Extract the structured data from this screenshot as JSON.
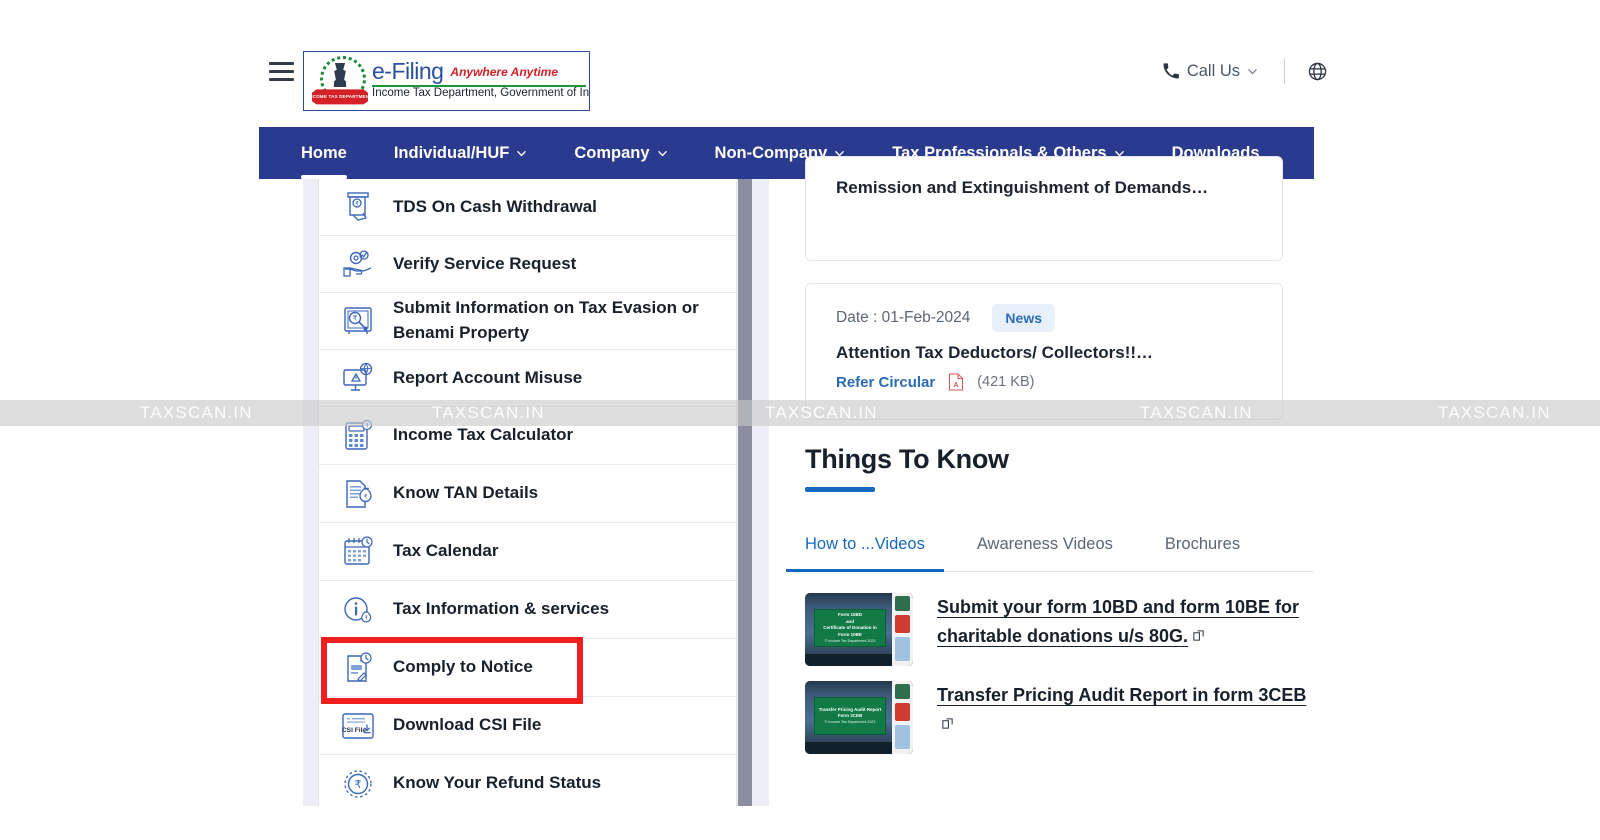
{
  "header": {
    "menu_icon": "hamburger-icon",
    "logo": {
      "brand": "e-Filing",
      "tagline": "Anywhere Anytime",
      "subtitle": "Income Tax Department, Government of India",
      "emblem_ribbon": "INCOME TAX DEPARTMENT"
    },
    "call_us_label": "Call Us",
    "phone_icon": "phone-icon",
    "caret_icon": "chevron-down-icon",
    "language_icon": "globe-icon"
  },
  "nav": {
    "items": [
      {
        "label": "Home",
        "has_caret": false,
        "active": true
      },
      {
        "label": "Individual/HUF",
        "has_caret": true,
        "active": false
      },
      {
        "label": "Company",
        "has_caret": true,
        "active": false
      },
      {
        "label": "Non-Company",
        "has_caret": true,
        "active": false
      },
      {
        "label": "Tax Professionals & Others",
        "has_caret": true,
        "active": false
      },
      {
        "label": "Downloads",
        "has_caret": false,
        "active": false
      }
    ]
  },
  "sidebar": {
    "items": [
      {
        "label": "TDS On Cash Withdrawal",
        "icon": "atm-cash-icon",
        "highlighted": false
      },
      {
        "label": "Verify Service Request",
        "icon": "hand-gear-check-icon",
        "highlighted": false
      },
      {
        "label": "Submit Information on Tax Evasion or Benami Property",
        "icon": "safe-magnifier-rupee-icon",
        "highlighted": false
      },
      {
        "label": "Report Account Misuse",
        "icon": "monitor-warning-icon",
        "highlighted": false
      },
      {
        "label": "Income Tax Calculator",
        "icon": "calculator-rupee-icon",
        "highlighted": false
      },
      {
        "label": "Know TAN Details",
        "icon": "document-money-bag-icon",
        "highlighted": false
      },
      {
        "label": "Tax Calendar",
        "icon": "calendar-clock-icon",
        "highlighted": false
      },
      {
        "label": "Tax Information & services",
        "icon": "info-rupee-icon",
        "highlighted": false
      },
      {
        "label": "Comply to Notice",
        "icon": "document-clock-edit-icon",
        "highlighted": true
      },
      {
        "label": "Download CSI File",
        "icon": "csi-file-download-icon",
        "highlighted": false
      },
      {
        "label": "Know Your Refund Status",
        "icon": "refund-rupee-coin-icon",
        "highlighted": false
      }
    ]
  },
  "news_cards": [
    {
      "title": "Remission and Extinguishment of Demands…"
    },
    {
      "date_label": "Date : 01-Feb-2024",
      "tag": "News",
      "title": "Attention Tax Deductors/ Collectors!!…",
      "link_label": "Refer Circular",
      "attachment_icon": "pdf-icon",
      "file_size": "(421 KB)"
    }
  ],
  "things_to_know": {
    "heading": "Things To Know",
    "tabs": [
      {
        "label": "How to ...Videos",
        "active": true
      },
      {
        "label": "Awareness Videos",
        "active": false
      },
      {
        "label": "Brochures",
        "active": false
      }
    ],
    "videos": [
      {
        "title": "Submit your form 10BD and form 10BE for charitable donations u/s 80G.",
        "external_icon": "external-link-icon",
        "thumb_line1": "Form 10BD",
        "thumb_line2": "and",
        "thumb_line3": "Certificate of Donation in Form 10BE",
        "thumb_line4": "© Income Tax Department 2023"
      },
      {
        "title": "Transfer Pricing Audit Report in form 3CEB",
        "external_icon": "external-link-icon",
        "thumb_line1": "Transfer Pricing Audit Report",
        "thumb_line2": "",
        "thumb_line3": "Form 3CEB",
        "thumb_line4": "© Income Tax Department 2023"
      }
    ]
  },
  "annotation": {
    "highlight_color": "#ef1f20",
    "highlight_target": "Comply to Notice"
  },
  "watermark": {
    "text": "TAXSCAN.IN",
    "repeat_x": [
      140,
      432,
      765,
      1140,
      1438
    ]
  },
  "colors": {
    "nav_blue": "#2a3a8f",
    "accent_blue": "#1769c0",
    "link_blue": "#2b6cb8",
    "icon_blue": "#3b66b8",
    "text_dark": "#18202b",
    "muted": "#5c6672"
  }
}
